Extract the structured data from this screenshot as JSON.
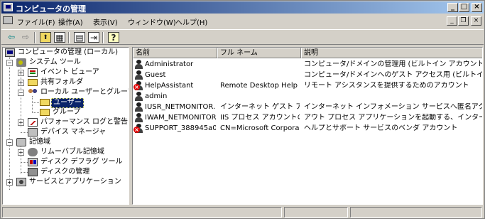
{
  "window": {
    "title": "コンピュータの管理",
    "controls": {
      "minimize": "_",
      "maximize": "□",
      "close": "×"
    }
  },
  "menu": {
    "items": [
      "ファイル(F)",
      "操作(A)",
      "表示(V)",
      "ウィンドウ(W)",
      "ヘルプ(H)"
    ],
    "mdi_controls": {
      "minimize": "_",
      "restore": "❐",
      "close": "×"
    }
  },
  "toolbar": {
    "icons": [
      "back-arrow-icon",
      "forward-arrow-icon",
      "up-folder-icon",
      "show-tree-icon",
      "properties-icon",
      "export-list-icon",
      "help-icon"
    ],
    "glyphs": {
      "back": "⇦",
      "forward": "⇨",
      "up": "⬆",
      "tree": "▦",
      "properties": "▤",
      "export": "⇥",
      "help": "?"
    }
  },
  "tree": {
    "root": "コンピュータの管理 (ローカル)",
    "system_tools": "システム ツール",
    "event_viewer": "イベント ビューア",
    "shared_folders": "共有フォルダ",
    "local_users_groups": "ローカル ユーザーとグループ",
    "users": "ユーザー",
    "groups": "グループ",
    "perf_logs": "パフォーマンス ログと警告",
    "device_manager": "デバイス マネージャ",
    "storage": "記憶域",
    "removable_storage": "リムーバブル記憶域",
    "disk_defrag": "ディスク デフラグ ツール",
    "disk_management": "ディスクの管理",
    "services_apps": "サービスとアプリケーション",
    "expanders": {
      "minus": "−",
      "plus": "+"
    }
  },
  "list": {
    "columns": [
      "名前",
      "フル ネーム",
      "説明"
    ],
    "rows": [
      {
        "name": "Administrator",
        "full_name": "",
        "description": "コンピュータ/ドメインの管理用 (ビルトイン アカウント)",
        "disabled": false
      },
      {
        "name": "Guest",
        "full_name": "",
        "description": "コンピュータ/ドメインへのゲスト アクセス用 (ビルトイン アカ...",
        "disabled": false
      },
      {
        "name": "HelpAssistant",
        "full_name": "Remote Desktop Help ...",
        "description": "リモート アシスタンスを提供するためのアカウント",
        "disabled": true
      },
      {
        "name": "admin",
        "full_name": "",
        "description": "",
        "disabled": false
      },
      {
        "name": "IUSR_NETMONITOR...",
        "full_name": "インターネット ゲスト アカ...",
        "description": "インターネット インフォメーション サービスへ匿名アクセスす...",
        "disabled": false
      },
      {
        "name": "IWAM_NETMONITOR...",
        "full_name": "IIS プロセス アカウントの...",
        "description": "アウト プロセス アプリケーションを起動する、インターネット ...",
        "disabled": false
      },
      {
        "name": "SUPPORT_388945a0",
        "full_name": "CN=Microsoft Corpora...",
        "description": "ヘルプとサポート サービスのベンダ アカウント",
        "disabled": true
      }
    ]
  },
  "colors": {
    "title_start": "#0a246a",
    "title_end": "#a6caf0",
    "selection": "#0a246a",
    "face": "#d4d0c8"
  }
}
